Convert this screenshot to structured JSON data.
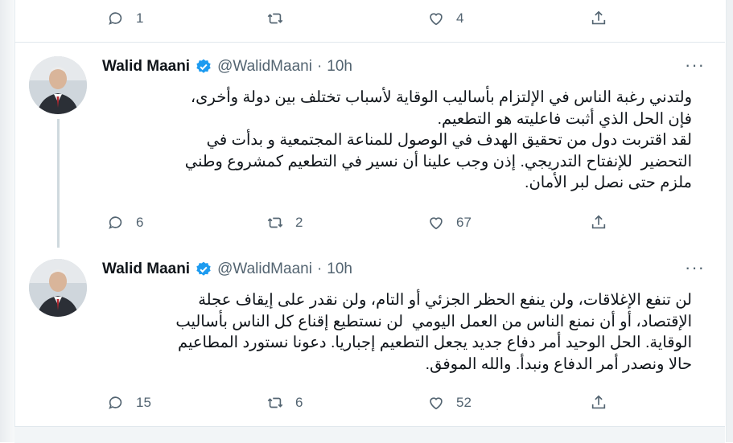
{
  "top_actions": {
    "reply_count": "1",
    "retweet_count": "",
    "like_count": "4"
  },
  "tweets": [
    {
      "display_name": "Walid Maani",
      "handle": "@WalidMaani",
      "time": "10h",
      "more": "···",
      "text": "ولتدني رغبة الناس في الإلتزام بأساليب الوقاية لأسباب تختلف بين دولة وأخرى،\nفإن الحل الذي أثبت فاعليته هو التطعيم.\nلقد اقتربت دول من تحقيق الهدف في الوصول للمناعة المجتمعية و بدأت في\nالتحضير  للإنفتاح التدريجي. إذن وجب علينا أن نسير في التطعيم كمشروع وطني\nملزم حتى نصل لبر الأمان.",
      "reply_count": "6",
      "retweet_count": "2",
      "like_count": "67"
    },
    {
      "display_name": "Walid Maani",
      "handle": "@WalidMaani",
      "time": "10h",
      "more": "···",
      "text": "لن تنفع الإغلاقات، ولن ينفع الحظر الجزئي أو التام، ولن نقدر على إيقاف عجلة\nالإقتصاد، أو أن نمنع الناس من العمل اليومي  لن نستطيع إقناع كل الناس بأساليب\nالوقاية. الحل الوحيد أمر دفاع جديد يجعل التطعيم إجباريا. دعونا نستورد المطاعيم\nحالا ونصدر أمر الدفاع ونبدأ. والله الموفق.",
      "reply_count": "15",
      "retweet_count": "6",
      "like_count": "52"
    }
  ],
  "colors": {
    "accent": "#1d9bf0",
    "muted": "#536471",
    "text": "#0f1419"
  },
  "icons": [
    "reply-icon",
    "retweet-icon",
    "like-icon",
    "share-icon",
    "verified-badge-icon",
    "more-icon"
  ]
}
